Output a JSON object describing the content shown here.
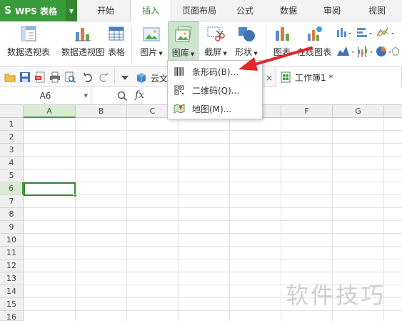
{
  "app": {
    "logo_text": "WPS 表格",
    "logo_letter": "S"
  },
  "tabs": [
    {
      "label": "开始"
    },
    {
      "label": "插入",
      "active": true
    },
    {
      "label": "页面布局"
    },
    {
      "label": "公式"
    },
    {
      "label": "数据"
    },
    {
      "label": "审阅"
    },
    {
      "label": "视图"
    }
  ],
  "ribbon": {
    "pivot_table": "数据透视表",
    "pivot_chart": "数据透视图",
    "table": "表格",
    "picture": "图片",
    "gallery": "图库",
    "screenshot": "截屏",
    "shape": "形状",
    "chart": "图表",
    "online_chart": "在线图表"
  },
  "qat": {
    "cloud_doc": "云文",
    "close_glyph": "×",
    "workbook_tab": "工作簿1 *"
  },
  "formula_bar": {
    "name_box": "A6",
    "fx": "fx"
  },
  "grid": {
    "columns": [
      "A",
      "B",
      "C",
      "D",
      "E",
      "F",
      "G"
    ],
    "rows": [
      "1",
      "2",
      "3",
      "4",
      "5",
      "6",
      "7",
      "8",
      "9",
      "10",
      "11",
      "12",
      "13",
      "14",
      "15",
      "16"
    ],
    "selected_column": "A",
    "selected_row": "6"
  },
  "gallery_menu": {
    "items": [
      {
        "label": "条形码(B)...",
        "icon": "barcode-icon"
      },
      {
        "label": "二维码(Q)...",
        "icon": "qrcode-icon"
      },
      {
        "label": "地图(M)...",
        "icon": "map-icon"
      }
    ]
  },
  "watermark": "软件技巧",
  "colors": {
    "accent_green": "#3a9b3b",
    "arrow_red": "#e2262a"
  }
}
